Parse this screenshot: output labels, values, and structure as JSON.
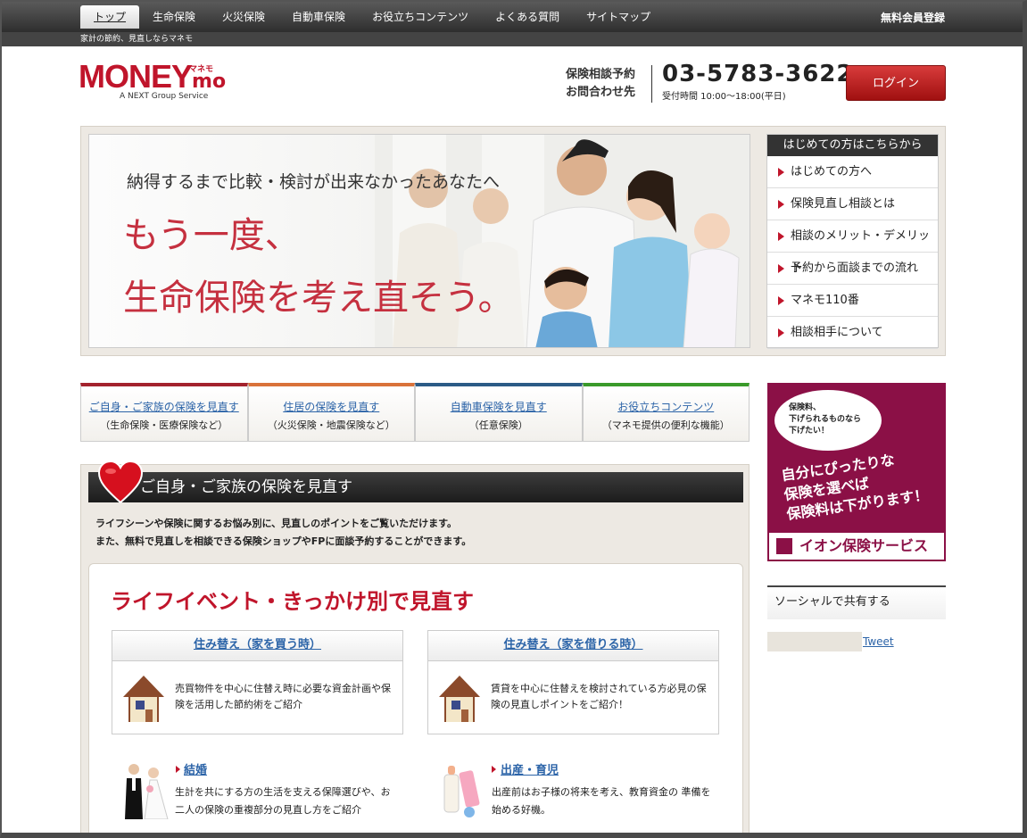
{
  "nav": {
    "items": [
      "トップ",
      "生命保険",
      "火災保険",
      "自動車保険",
      "お役立ちコンテンツ",
      "よくある質問",
      "サイトマップ"
    ],
    "register": "無料会員登録",
    "subtitle": "家計の節約、見直しならマネモ"
  },
  "logo": {
    "money": "MONEY",
    "mo": "mo",
    "kana": "マネモ",
    "tagline": "A NEXT Group Service"
  },
  "contact": {
    "line1": "保険相談予約",
    "line2": "お問合わせ先",
    "phone": "03-5783-3622",
    "hours": "受付時間 10:00～18:00(平日)"
  },
  "login": "ログイン",
  "hero": {
    "line1": "納得するまで比較・検討が出来なかったあなたへ",
    "line2": "もう一度、",
    "line3": "生命保険を考え直そう。"
  },
  "sidemenu": {
    "title": "はじめての方はこちらから",
    "items": [
      "はじめての方へ",
      "保険見直し相談とは",
      "相談のメリット・デメリット",
      "予約から面談までの流れ",
      "マネモ110番",
      "相談相手について"
    ]
  },
  "categories": [
    {
      "title": "ご自身・ご家族の保険を見直す",
      "sub": "（生命保険・医療保険など）",
      "color": "#a3222d"
    },
    {
      "title": "住居の保険を見直す",
      "sub": "（火災保険・地震保険など）",
      "color": "#d9723a"
    },
    {
      "title": "自動車保険を見直す",
      "sub": "（任意保険）",
      "color": "#2b5b86"
    },
    {
      "title": "お役立ちコンテンツ",
      "sub": "（マネモ提供の便利な機能）",
      "color": "#3a9a2a"
    }
  ],
  "ad": {
    "bubble1": "保険料、",
    "bubble2": "下げられるものなら",
    "bubble3": "下げたい！",
    "main1": "自分にぴったりな",
    "main2": "保険を選べば",
    "main3": "保険料は下がります！",
    "brand": "イオン保険サービス"
  },
  "social": {
    "title": "ソーシャルで共有する",
    "tweet": "Tweet"
  },
  "section": {
    "title": "ご自身・ご家族の保険を見直す",
    "intro1": "ライフシーンや保険に関するお悩み別に、見直しのポイントをご覧いただけます。",
    "intro2": "また、無料で見直しを相談できる保険ショップやFPに面談予約することができます。",
    "panel_title": "ライフイベント・きっかけ別で見直す",
    "boxes": [
      {
        "title": "住み替え（家を買う時）",
        "text": "売買物件を中心に住替え時に必要な資金計画や保険を活用した節約術をご紹介"
      },
      {
        "title": "住み替え（家を借りる時）",
        "text": "賃貸を中心に住替えを検討されている方必見の保険の見直しポイントをご紹介！"
      }
    ],
    "events": [
      {
        "title": "結婚",
        "text": "生計を共にする方の生活を支える保障選びや、お二人の保険の重複部分の見直し方をご紹介"
      },
      {
        "title": "出産・育児",
        "text": "出産前はお子様の将来を考え、教育資金の 準備を始める好機。"
      }
    ]
  }
}
